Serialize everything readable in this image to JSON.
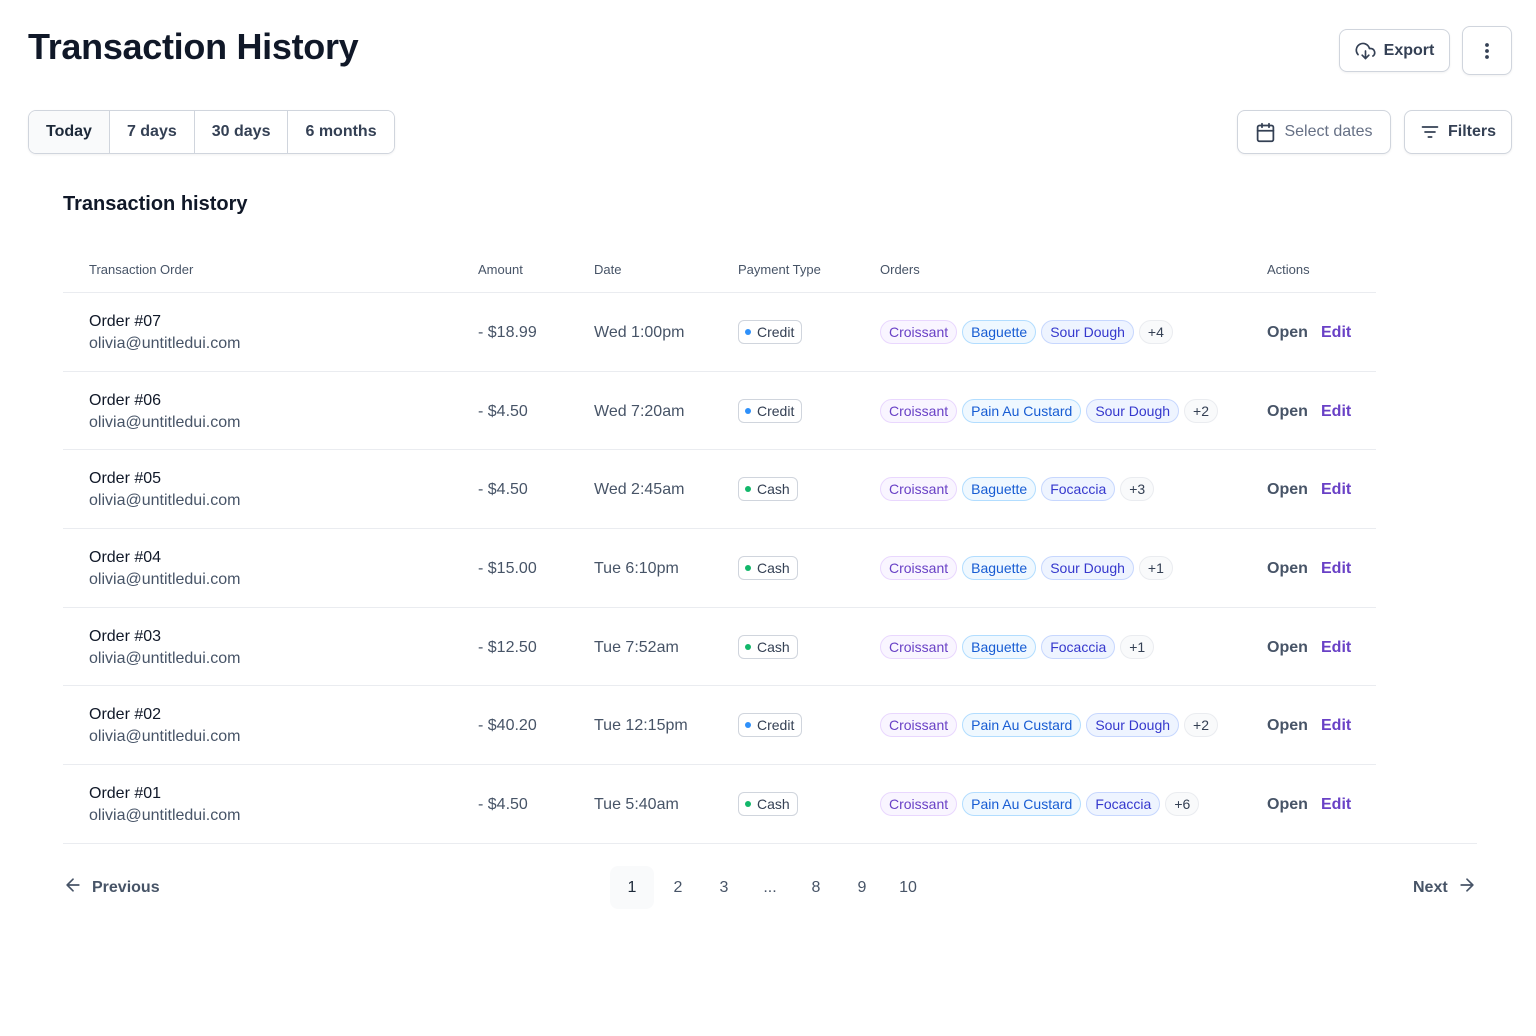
{
  "page": {
    "title": "Transaction History"
  },
  "toolbar": {
    "export_label": "Export",
    "more_icon": "dots-vertical-icon",
    "export_icon": "cloud-download-icon"
  },
  "range": {
    "options": [
      "Today",
      "7 days",
      "30 days",
      "6 months"
    ],
    "selected": "Today"
  },
  "filters": {
    "select_dates_label": "Select dates",
    "filters_label": "Filters",
    "calendar_icon": "calendar-icon",
    "filter_icon": "filter-lines-icon"
  },
  "section": {
    "title": "Transaction history"
  },
  "table": {
    "columns": [
      "Transaction Order",
      "Amount",
      "Date",
      "Payment Type",
      "Orders",
      "Actions"
    ],
    "rows": [
      {
        "order": "Order #07",
        "email": "olivia@untitledui.com",
        "amount": "- $18.99",
        "date": "Wed 1:00pm",
        "payment": "Credit",
        "items": [
          "Croissant",
          "Baguette",
          "Sour Dough"
        ],
        "more": "+4"
      },
      {
        "order": "Order #06",
        "email": "olivia@untitledui.com",
        "amount": "- $4.50",
        "date": "Wed 7:20am",
        "payment": "Credit",
        "items": [
          "Croissant",
          "Pain Au Custard",
          "Sour Dough"
        ],
        "more": "+2"
      },
      {
        "order": "Order #05",
        "email": "olivia@untitledui.com",
        "amount": "- $4.50",
        "date": "Wed 2:45am",
        "payment": "Cash",
        "items": [
          "Croissant",
          "Baguette",
          "Focaccia"
        ],
        "more": "+3"
      },
      {
        "order": "Order #04",
        "email": "olivia@untitledui.com",
        "amount": "- $15.00",
        "date": "Tue 6:10pm",
        "payment": "Cash",
        "items": [
          "Croissant",
          "Baguette",
          "Sour Dough"
        ],
        "more": "+1"
      },
      {
        "order": "Order #03",
        "email": "olivia@untitledui.com",
        "amount": "- $12.50",
        "date": "Tue 7:52am",
        "payment": "Cash",
        "items": [
          "Croissant",
          "Baguette",
          "Focaccia"
        ],
        "more": "+1"
      },
      {
        "order": "Order #02",
        "email": "olivia@untitledui.com",
        "amount": "- $40.20",
        "date": "Tue 12:15pm",
        "payment": "Credit",
        "items": [
          "Croissant",
          "Pain Au Custard",
          "Sour Dough"
        ],
        "more": "+2"
      },
      {
        "order": "Order #01",
        "email": "olivia@untitledui.com",
        "amount": "- $4.50",
        "date": "Tue 5:40am",
        "payment": "Cash",
        "items": [
          "Croissant",
          "Pain Au Custard",
          "Focaccia"
        ],
        "more": "+6"
      }
    ],
    "actions": {
      "open_label": "Open",
      "edit_label": "Edit"
    },
    "payment_colors": {
      "Credit": "#2e90fa",
      "Cash": "#12b76a"
    }
  },
  "pagination": {
    "previous_label": "Previous",
    "next_label": "Next",
    "pages": [
      "1",
      "2",
      "3",
      "...",
      "8",
      "9",
      "10"
    ],
    "current": "1",
    "arrow_left_icon": "arrow-left-icon",
    "arrow_right_icon": "arrow-right-icon"
  },
  "colors": {
    "accent": "#6941c6",
    "border": "#d0d5dd",
    "text_primary": "#101828",
    "text_secondary": "#475467"
  }
}
